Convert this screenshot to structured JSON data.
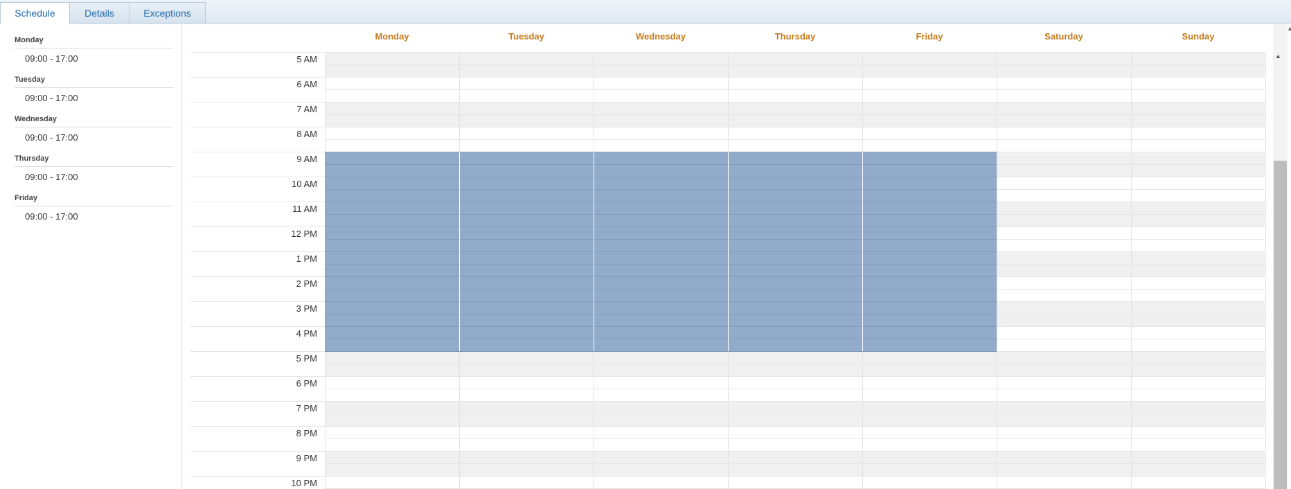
{
  "tabs": [
    {
      "label": "Schedule",
      "active": true
    },
    {
      "label": "Details",
      "active": false
    },
    {
      "label": "Exceptions",
      "active": false
    }
  ],
  "summary": [
    {
      "day": "Monday",
      "hours": "09:00 - 17:00"
    },
    {
      "day": "Tuesday",
      "hours": "09:00 - 17:00"
    },
    {
      "day": "Wednesday",
      "hours": "09:00 - 17:00"
    },
    {
      "day": "Thursday",
      "hours": "09:00 - 17:00"
    },
    {
      "day": "Friday",
      "hours": "09:00 - 17:00"
    }
  ],
  "calendar": {
    "days": [
      "Monday",
      "Tuesday",
      "Wednesday",
      "Thursday",
      "Friday",
      "Saturday",
      "Sunday"
    ],
    "hours": [
      "5 AM",
      "6 AM",
      "7 AM",
      "8 AM",
      "9 AM",
      "10 AM",
      "11 AM",
      "12 PM",
      "1 PM",
      "2 PM",
      "3 PM",
      "4 PM",
      "5 PM",
      "6 PM",
      "7 PM",
      "8 PM",
      "9 PM",
      "10 PM"
    ],
    "scheduled_days": [
      "Monday",
      "Tuesday",
      "Wednesday",
      "Thursday",
      "Friday"
    ],
    "scheduled_start_hour": "9 AM",
    "scheduled_end_hour": "5 PM"
  },
  "colors": {
    "day_header": "#c57a1a",
    "tab_text": "#1f6aab",
    "scheduled_block": "#93abcb",
    "alternate_row": "#f0f0f0"
  }
}
